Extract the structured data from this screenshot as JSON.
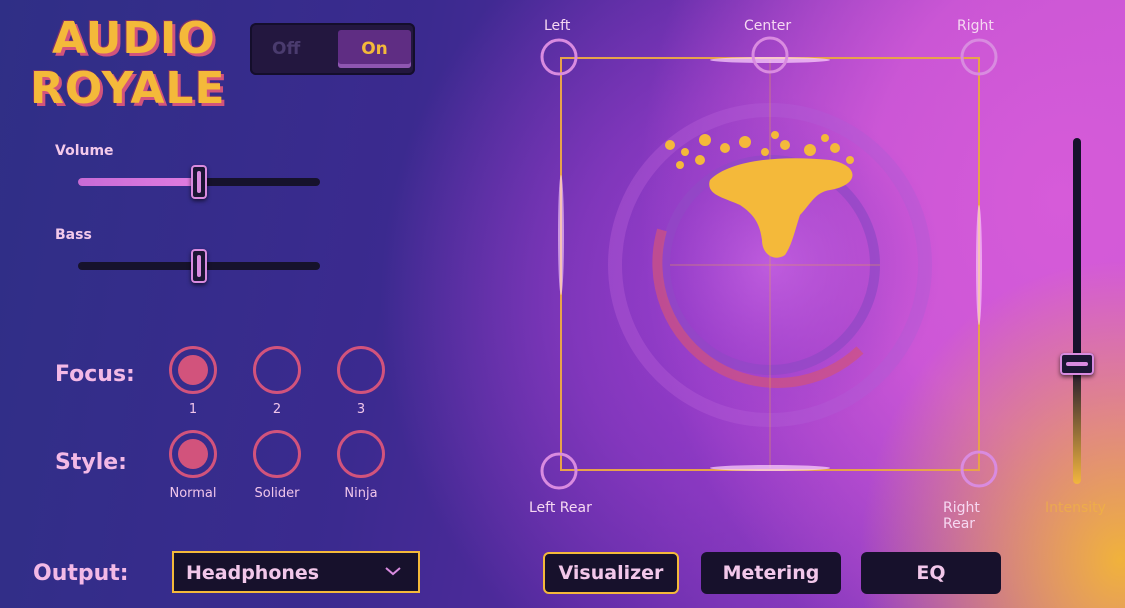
{
  "app": {
    "logo_line1": "AUDIO",
    "logo_line2": "ROYALE"
  },
  "power": {
    "off_label": "Off",
    "on_label": "On",
    "state": "On"
  },
  "sliders": {
    "volume": {
      "label": "Volume",
      "value_fraction": 0.5
    },
    "bass": {
      "label": "Bass",
      "value_fraction": 0.5
    }
  },
  "focus": {
    "label": "Focus:",
    "options": [
      "1",
      "2",
      "3"
    ],
    "selected": "1"
  },
  "style": {
    "label": "Style:",
    "options": [
      "Normal",
      "Solider",
      "Ninja"
    ],
    "selected": "Normal"
  },
  "output": {
    "label": "Output:",
    "value": "Headphones"
  },
  "tabs": {
    "items": [
      "Visualizer",
      "Metering",
      "EQ"
    ],
    "active": "Visualizer"
  },
  "visualizer": {
    "speakers": {
      "left": "Left",
      "center": "Center",
      "right": "Right",
      "left_rear": "Left Rear",
      "right_rear": "Right Rear"
    }
  },
  "intensity": {
    "label": "Intensity",
    "value_fraction": 0.35
  },
  "colors": {
    "accent_gold": "#f4b93a",
    "accent_pink": "#d2537c",
    "accent_lilac": "#d98be0",
    "panel_dark": "#17112c"
  }
}
